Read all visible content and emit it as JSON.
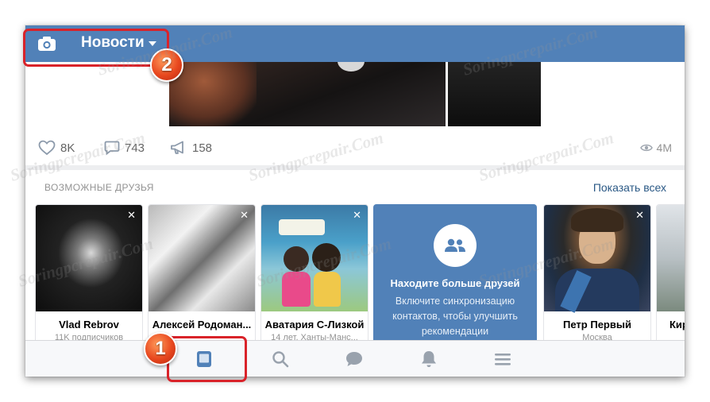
{
  "header": {
    "title": "Новости",
    "camera_icon": "camera-icon",
    "dropdown_icon": "caret-down-icon",
    "color": "#5181b8"
  },
  "post": {
    "likes": "8K",
    "comments": "743",
    "shares": "158",
    "views": "4M"
  },
  "friends": {
    "title": "ВОЗМОЖНЫЕ ДРУЗЬЯ",
    "show_all": "Показать всех",
    "cards": [
      {
        "name": "Vlad Rebrov",
        "sub": "11K подписчиков"
      },
      {
        "name": "Алексей Родоман...",
        "sub": ""
      },
      {
        "name": "Аватария С-Лизкой",
        "sub": "14 лет, Ханты-Манс..."
      },
      {
        "name": "Петр Первый",
        "sub": "Москва"
      },
      {
        "name": "Кир",
        "sub": ""
      }
    ],
    "find_card": {
      "title": "Находите больше друзей",
      "desc": "Включите синхронизацию контактов, чтобы улучшить рекомендации"
    },
    "close_glyph": "✕"
  },
  "tabbar": {
    "tabs": [
      "news-tab",
      "search-tab",
      "messages-tab",
      "notifications-tab",
      "menu-tab"
    ]
  },
  "annotations": {
    "badge1": "1",
    "badge2": "2",
    "highlight_color": "#d9232a"
  },
  "watermark": "Soringpcrepair.Com"
}
